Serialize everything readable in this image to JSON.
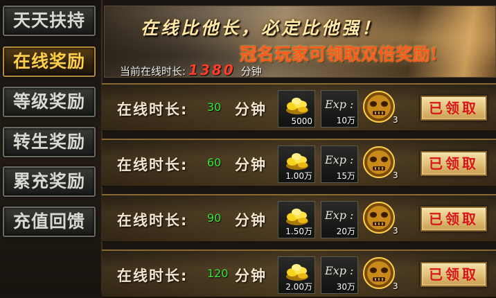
{
  "sidebar": {
    "items": [
      {
        "label": "天天扶持",
        "active": false
      },
      {
        "label": "在线奖励",
        "active": true
      },
      {
        "label": "等级奖励",
        "active": false
      },
      {
        "label": "转生奖励",
        "active": false
      },
      {
        "label": "累充奖励",
        "active": false
      },
      {
        "label": "充值回馈",
        "active": false
      }
    ]
  },
  "banner": {
    "slogan": "在线比他长，必定比他强！",
    "promo": "冠名玩家可领取双倍奖励!",
    "online_prefix": "当前在线时长:",
    "online_minutes": "1380",
    "online_unit": "分钟"
  },
  "rewards": {
    "label": "在线时长:",
    "unit": "分钟",
    "exp_label": "Exp :",
    "rows": [
      {
        "minutes": "30",
        "gold": "5000",
        "exp": "10万",
        "mask": "3",
        "button": "已领取"
      },
      {
        "minutes": "60",
        "gold": "1.00万",
        "exp": "15万",
        "mask": "3",
        "button": "已领取"
      },
      {
        "minutes": "90",
        "gold": "1.50万",
        "exp": "20万",
        "mask": "3",
        "button": "已领取"
      },
      {
        "minutes": "120",
        "gold": "2.00万",
        "exp": "30万",
        "mask": "3",
        "button": "已领取"
      }
    ]
  },
  "colors": {
    "active_tab": "#ffcf4a",
    "claim_text": "#d8161c",
    "minutes": "#36e636"
  },
  "icons": {
    "gold": "gold-ingot-icon",
    "mask": "golden-mask-icon"
  }
}
